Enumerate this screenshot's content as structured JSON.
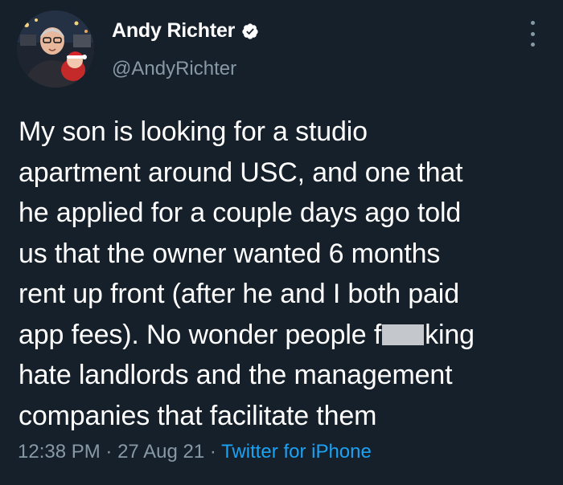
{
  "author": {
    "display_name": "Andy Richter",
    "handle": "@AndyRichter",
    "verified": true
  },
  "tweet": {
    "lines": [
      "My son is looking for a studio",
      "apartment around USC, and one that",
      "he applied for a couple days ago told",
      "us that the owner wanted 6 months",
      "rent up front (after he and I both paid"
    ],
    "line6_before": "app fees). No wonder people f",
    "line6_after": "king",
    "lines_end": [
      "hate landlords and the management",
      "companies that facilitate them"
    ]
  },
  "meta": {
    "time": "12:38 PM",
    "separator": "·",
    "date": "27 Aug 21",
    "source": "Twitter for iPhone"
  },
  "colors": {
    "background": "#15202b",
    "text": "#ffffff",
    "secondary": "#8899a6",
    "accent": "#1da1f2",
    "censor_bar": "#c4c7cc"
  },
  "icons": {
    "verified": "verified-badge-icon",
    "more": "more-options-icon"
  }
}
